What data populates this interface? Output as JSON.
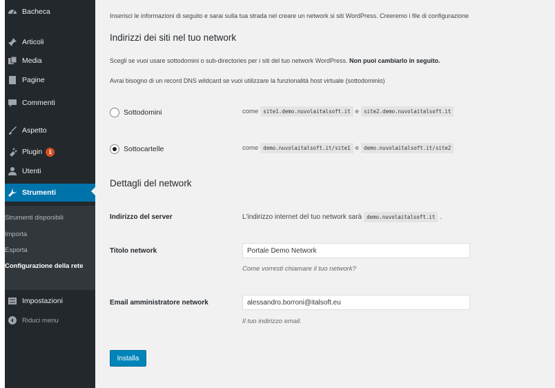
{
  "sidebar": {
    "items": [
      {
        "label": "Bacheca",
        "icon": "dashboard-icon"
      },
      {
        "label": "Articoli",
        "icon": "pin-icon"
      },
      {
        "label": "Media",
        "icon": "media-icon"
      },
      {
        "label": "Pagine",
        "icon": "page-icon"
      },
      {
        "label": "Commenti",
        "icon": "comment-icon"
      },
      {
        "label": "Aspetto",
        "icon": "brush-icon"
      },
      {
        "label": "Plugin",
        "icon": "plugin-icon",
        "badge": "1"
      },
      {
        "label": "Utenti",
        "icon": "users-icon"
      },
      {
        "label": "Strumenti",
        "icon": "wrench-icon"
      }
    ],
    "submenu": [
      {
        "label": "Strumenti disponibili"
      },
      {
        "label": "Importa"
      },
      {
        "label": "Esporta"
      },
      {
        "label": "Configurazione della rete"
      }
    ],
    "settings": {
      "label": "Impostazioni",
      "icon": "settings-icon"
    },
    "collapse": {
      "label": "Riduci menu",
      "icon": "collapse-icon"
    }
  },
  "main": {
    "intro": "Inserisci le informazioni di seguito e sarai sulla tua strada nel creare un network si siti WordPress. Creeremo i file di configurazione",
    "sites_heading": "Indirizzi dei siti nel tuo network",
    "choice_text": "Scegli se vuoi usare sottodomini o sub-directories per i siti del tuo network WordPress.",
    "choice_bold": "Non puoi cambiarlo in seguito.",
    "dns_text": "Avrai bisogno di un record DNS wildcard se vuoi utilizzare la funzionalità host virtuale (sottodominio)",
    "options": [
      {
        "label": "Sottodomini",
        "checked": false,
        "come": "come",
        "ex1": "site1.demo.nuvolaitalsoft.it",
        "sep": "e",
        "ex2": "site2.demo.nuvolaitalsoft.it"
      },
      {
        "label": "Sottocartelle",
        "checked": true,
        "come": "come",
        "ex1": "demo.nuvolaitalsoft.it/site1",
        "sep": "e",
        "ex2": "demo.nuvolaitalsoft.it/site2"
      }
    ],
    "details_heading": "Dettagli del network",
    "server_label": "Indirizzo del server",
    "server_text": "L'indirizzo internet del tuo network sarà",
    "server_value": "demo.nuvolaitalsoft.it",
    "server_suffix": ".",
    "title_label": "Titolo network",
    "title_value": "Portale Demo Network",
    "title_desc": "Come vorresti chiamare il tuo network?",
    "email_label": "Email amministratore network",
    "email_value": "alessandro.borroni@italsoft.eu",
    "email_desc": "Il tuo indirizzo email.",
    "install_button": "Installa"
  }
}
